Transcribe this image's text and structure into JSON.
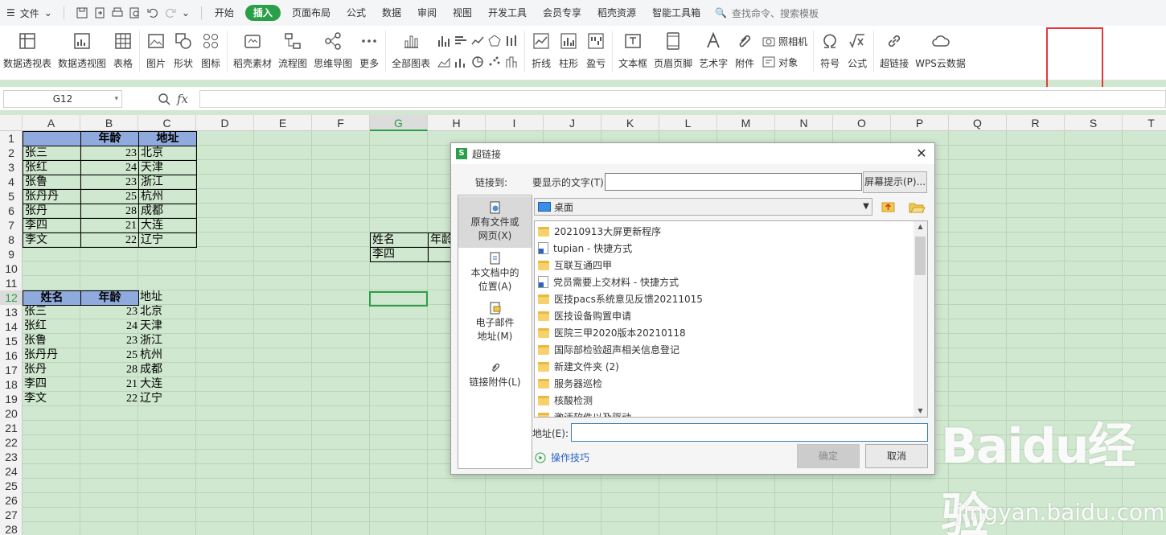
{
  "menubar": {
    "file": "文件",
    "tabs": [
      "开始",
      "插入",
      "页面布局",
      "公式",
      "数据",
      "审阅",
      "视图",
      "开发工具",
      "会员专享",
      "稻壳资源",
      "智能工具箱"
    ],
    "active_tab": "插入",
    "search": "查找命令、搜索模板"
  },
  "ribbon": {
    "pivot_table": "数据透视表",
    "pivot_chart": "数据透视图",
    "table": "表格",
    "picture": "图片",
    "shape": "形状",
    "icon": "图标",
    "daoke": "稻壳素材",
    "flowchart": "流程图",
    "mindmap": "思维导图",
    "more": "更多",
    "all_charts": "全部图表",
    "line": "折线",
    "column": "柱形",
    "winloss": "盈亏",
    "textbox": "文本框",
    "header_footer": "页眉页脚",
    "wordart": "艺术字",
    "attachment": "附件",
    "camera": "照相机",
    "object": "对象",
    "symbol": "符号",
    "formula": "公式",
    "hyperlink": "超链接",
    "wps_cloud": "WPS云数据"
  },
  "namebox": "G12",
  "fx_label": "fx",
  "columns": [
    "A",
    "B",
    "C",
    "D",
    "E",
    "F",
    "G",
    "H",
    "I",
    "J",
    "K",
    "L",
    "M",
    "N",
    "O",
    "P",
    "Q",
    "R",
    "S",
    "T"
  ],
  "rows": [
    "1",
    "2",
    "3",
    "4",
    "5",
    "6",
    "7",
    "8",
    "9",
    "10",
    "11",
    "12",
    "13",
    "14",
    "15",
    "16",
    "17",
    "18",
    "19",
    "20",
    "21",
    "22",
    "23",
    "24",
    "25",
    "26",
    "27",
    "28"
  ],
  "table1": {
    "header": [
      "",
      "年龄",
      "地址"
    ],
    "rows": [
      [
        "张三",
        "23",
        "北京"
      ],
      [
        "张红",
        "24",
        "天津"
      ],
      [
        "张鲁",
        "23",
        "浙江"
      ],
      [
        "张丹丹",
        "25",
        "杭州"
      ],
      [
        "张丹",
        "28",
        "成都"
      ],
      [
        "李四",
        "21",
        "大连"
      ],
      [
        "李文",
        "22",
        "辽宁"
      ]
    ]
  },
  "table2": {
    "header": [
      "姓名",
      "年龄",
      "地址"
    ],
    "rows": [
      [
        "张三",
        "23",
        "北京"
      ],
      [
        "张红",
        "24",
        "天津"
      ],
      [
        "张鲁",
        "23",
        "浙江"
      ],
      [
        "张丹丹",
        "25",
        "杭州"
      ],
      [
        "张丹",
        "28",
        "成都"
      ],
      [
        "李四",
        "21",
        "大连"
      ],
      [
        "李文",
        "22",
        "辽宁"
      ]
    ]
  },
  "lookup": {
    "h1": "姓名",
    "h2": "年龄",
    "v1": "李四"
  },
  "dialog": {
    "title": "超链接",
    "link_to": "链接到:",
    "display_text_label": "要显示的文字(T):",
    "display_text_value": "",
    "screen_tip": "屏幕提示(P)...",
    "left_items": [
      "原有文件或网页(X)",
      "本文档中的位置(A)",
      "电子邮件地址(M)",
      "链接附件(L)"
    ],
    "folder": "桌面",
    "files": [
      {
        "name": "20210913大屏更新程序",
        "type": "folder"
      },
      {
        "name": "tupian - 快捷方式",
        "type": "shortcut"
      },
      {
        "name": "互联互通四甲",
        "type": "folder"
      },
      {
        "name": "党员需要上交材料 - 快捷方式",
        "type": "shortcut"
      },
      {
        "name": "医技pacs系统意见反馈20211015",
        "type": "folder"
      },
      {
        "name": "医技设备购置申请",
        "type": "folder"
      },
      {
        "name": "医院三甲2020版本20210118",
        "type": "folder"
      },
      {
        "name": "国际部检验超声相关信息登记",
        "type": "folder"
      },
      {
        "name": "新建文件夹 (2)",
        "type": "folder"
      },
      {
        "name": "服务器巡检",
        "type": "folder"
      },
      {
        "name": "核酸检测",
        "type": "folder"
      },
      {
        "name": "激活软件以及驱动",
        "type": "folder"
      }
    ],
    "address_label": "地址(E):",
    "address_value": "",
    "tips": "操作技巧",
    "ok": "确定",
    "cancel": "取消"
  },
  "watermark": {
    "logo": "Baidu经验",
    "url": "jingyan.baidu.com"
  }
}
